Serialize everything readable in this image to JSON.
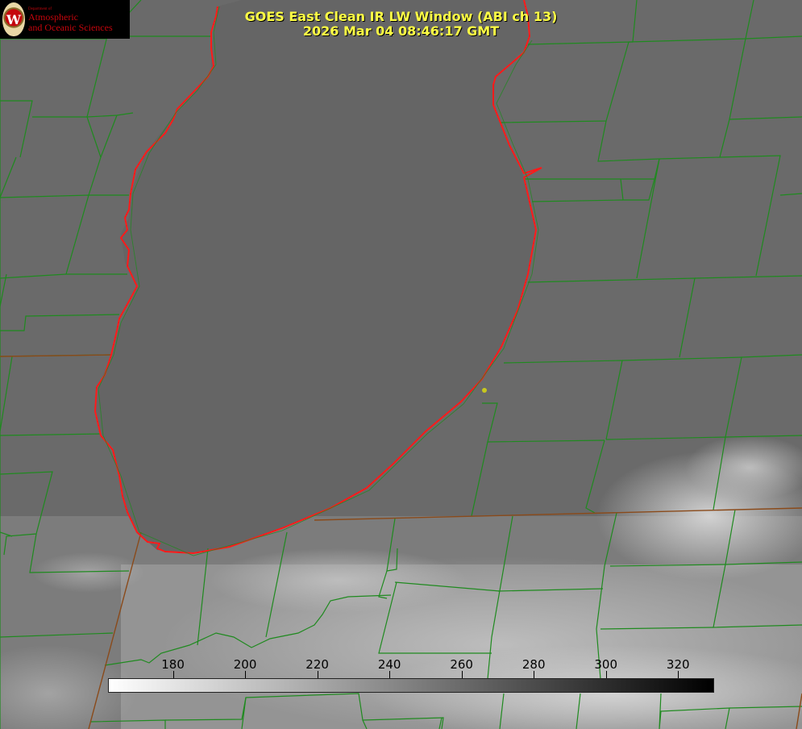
{
  "logo": {
    "seal_letter": "W",
    "department": "Department of",
    "line1": "Atmospheric",
    "line2": "and Oceanic Sciences"
  },
  "title": {
    "line1": "GOES East Clean IR LW Window (ABI ch 13)",
    "line2": "2026 Mar 04 08:46:17 GMT"
  },
  "colorbar": {
    "min": 162,
    "max": 330,
    "ticks": [
      "180",
      "200",
      "220",
      "240",
      "260",
      "280",
      "300",
      "320"
    ],
    "gradient": [
      "#ffffff",
      "#000000"
    ]
  },
  "colors": {
    "background_gray": "#6a6a6a",
    "lake_gray": "#656565",
    "county_lines": "#1f8a1f",
    "shoreline": "#ff1a1a",
    "state_lines": "#8a4a1a",
    "title_text": "#ffff44",
    "marker": "#c8c81e"
  }
}
